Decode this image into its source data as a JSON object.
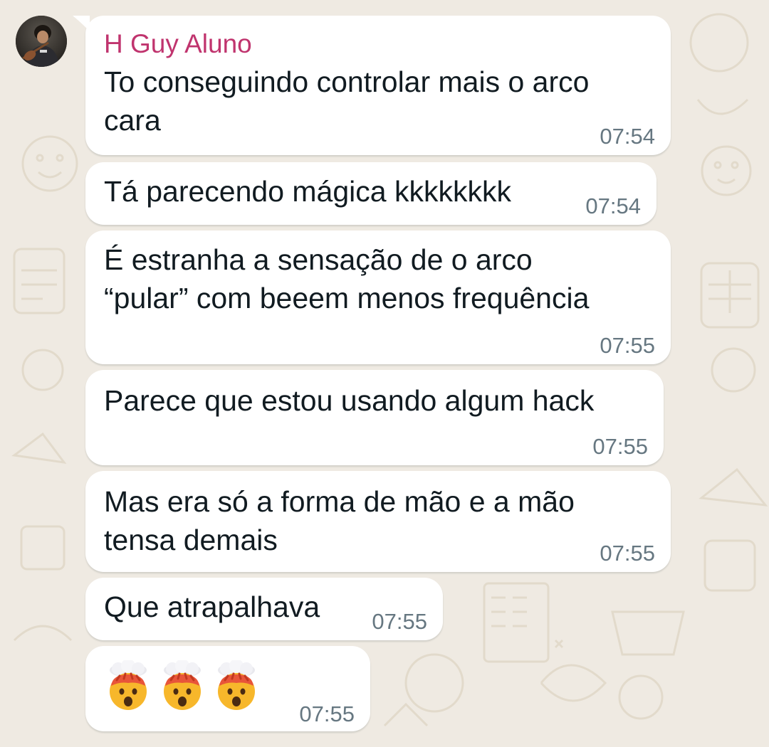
{
  "chat": {
    "sender": {
      "name": "H Guy Aluno",
      "name_color": "#c0346e",
      "avatar": "profile-photo"
    },
    "messages": [
      {
        "lines": [
          "To conseguindo controlar mais o arco",
          "cara"
        ],
        "time": "07:54"
      },
      {
        "lines": [
          "Tá parecendo mágica kkkkkkkk"
        ],
        "time": "07:54"
      },
      {
        "lines": [
          "É estranha a sensação de o arco",
          "“pular” com beeem menos frequência"
        ],
        "time": "07:55"
      },
      {
        "lines": [
          "Parece que estou usando algum hack"
        ],
        "time": "07:55"
      },
      {
        "lines": [
          "Mas era só a forma de mão e a mão",
          "tensa demais"
        ],
        "time": "07:55"
      },
      {
        "lines": [
          "Que atrapalhava"
        ],
        "time": "07:55"
      },
      {
        "emojis": [
          "exploding-head-emoji",
          "exploding-head-emoji",
          "exploding-head-emoji"
        ],
        "time": "07:55"
      }
    ]
  },
  "colors": {
    "background": "#efeae2",
    "bubble": "#ffffff",
    "text": "#111b21",
    "timestamp": "#667781",
    "doodle": "#e3dccf"
  }
}
